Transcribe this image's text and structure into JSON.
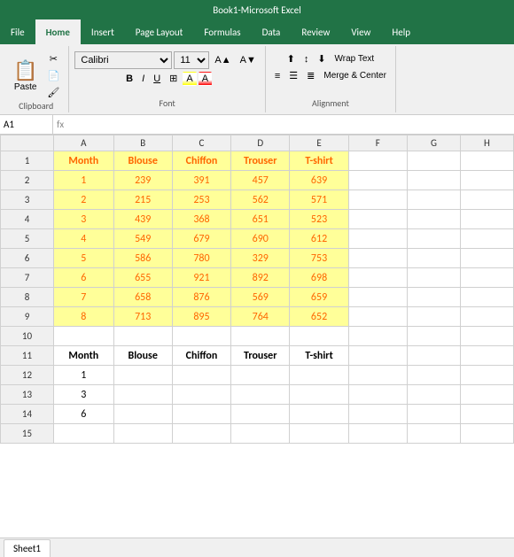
{
  "app": {
    "title": "Microsoft Excel",
    "file_name": "Book1"
  },
  "ribbon": {
    "tabs": [
      "File",
      "Home",
      "Insert",
      "Page Layout",
      "Formulas",
      "Data",
      "Review",
      "View",
      "Help"
    ],
    "active_tab": "Home"
  },
  "toolbar": {
    "font_name": "Calibri",
    "font_size": "11",
    "bold": "B",
    "italic": "I",
    "underline": "U",
    "wrap_text": "Wrap Text",
    "merge_center": "Merge & Center",
    "paste": "Paste",
    "clipboard_label": "Clipboard",
    "font_label": "Font",
    "alignment_label": "Alignment"
  },
  "formula_bar": {
    "cell_ref": "A1",
    "formula": ""
  },
  "columns": {
    "headers": [
      "",
      "A",
      "B",
      "C",
      "D",
      "E",
      "F",
      "G",
      "H"
    ]
  },
  "table1": {
    "header": [
      "Month",
      "Blouse",
      "Chiffon",
      "Trouser",
      "T-shirt"
    ],
    "rows": [
      {
        "row": 1,
        "month": 1,
        "blouse": 239,
        "chiffon": 391,
        "trouser": 457,
        "tshirt": 639
      },
      {
        "row": 2,
        "month": 2,
        "blouse": 215,
        "chiffon": 253,
        "trouser": 562,
        "tshirt": 571
      },
      {
        "row": 3,
        "month": 3,
        "blouse": 439,
        "chiffon": 368,
        "trouser": 651,
        "tshirt": 523
      },
      {
        "row": 4,
        "month": 4,
        "blouse": 549,
        "chiffon": 679,
        "trouser": 690,
        "tshirt": 612
      },
      {
        "row": 5,
        "month": 5,
        "blouse": 586,
        "chiffon": 780,
        "trouser": 329,
        "tshirt": 753
      },
      {
        "row": 6,
        "month": 6,
        "blouse": 655,
        "chiffon": 921,
        "trouser": 892,
        "tshirt": 698
      },
      {
        "row": 7,
        "month": 7,
        "blouse": 658,
        "chiffon": 876,
        "trouser": 569,
        "tshirt": 659
      },
      {
        "row": 8,
        "month": 8,
        "blouse": 713,
        "chiffon": 895,
        "trouser": 764,
        "tshirt": 652
      }
    ]
  },
  "table2": {
    "header": [
      "Month",
      "Blouse",
      "Chiffon",
      "Trouser",
      "T-shirt"
    ],
    "rows": [
      {
        "row": 12,
        "month": 1,
        "blouse": "",
        "chiffon": "",
        "trouser": "",
        "tshirt": ""
      },
      {
        "row": 13,
        "month": 3,
        "blouse": "",
        "chiffon": "",
        "trouser": "",
        "tshirt": ""
      },
      {
        "row": 14,
        "month": 6,
        "blouse": "",
        "chiffon": "",
        "trouser": "",
        "tshirt": ""
      }
    ]
  },
  "sheet_tab": "Sheet1"
}
